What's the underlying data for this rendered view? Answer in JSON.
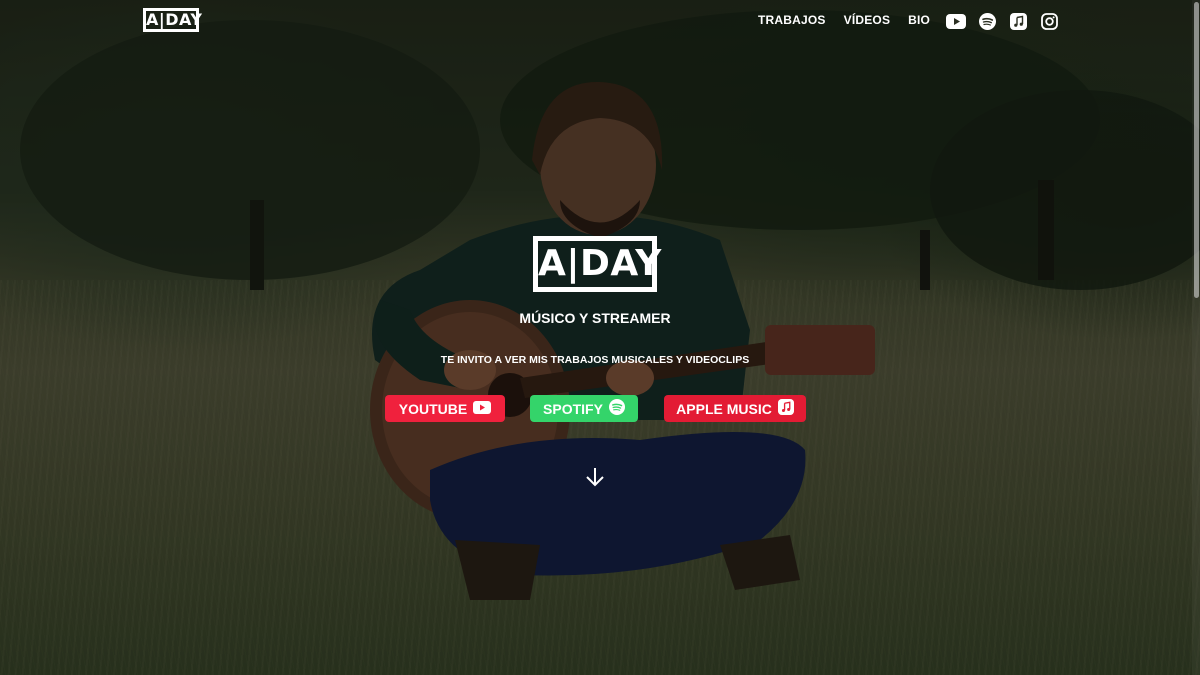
{
  "brand": {
    "logo_text": "A|DAY"
  },
  "nav": {
    "items": [
      {
        "label": "TRABAJOS"
      },
      {
        "label": "VÍDEOS"
      },
      {
        "label": "BIO"
      }
    ]
  },
  "social": {
    "icons": [
      "youtube-icon",
      "spotify-icon",
      "apple-music-icon",
      "instagram-icon"
    ]
  },
  "hero": {
    "logo_text": "A|DAY",
    "subtitle": "MÚSICO Y STREAMER",
    "tagline": "TE INVITO A VER MIS TRABAJOS MUSICALES Y VIDEOCLIPS",
    "buttons": [
      {
        "label": "YOUTUBE",
        "icon": "youtube-icon",
        "color": "#f0213d"
      },
      {
        "label": "SPOTIFY",
        "icon": "spotify-icon",
        "color": "#34d46a"
      },
      {
        "label": "APPLE MUSIC",
        "icon": "apple-music-icon",
        "color": "#e31b34"
      }
    ],
    "scroll_icon": "arrow-down-icon"
  }
}
